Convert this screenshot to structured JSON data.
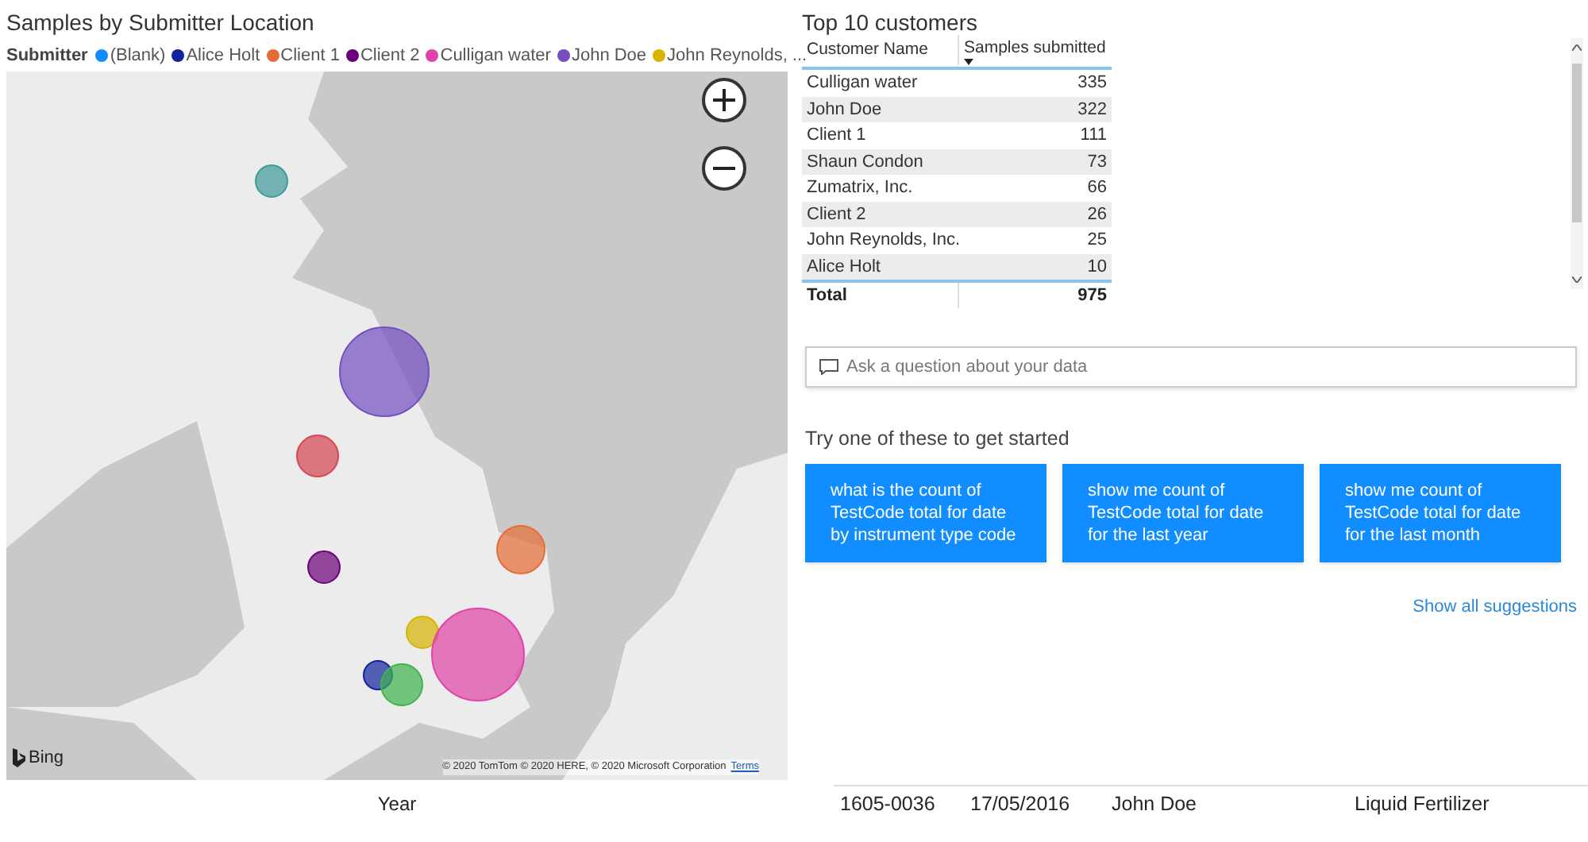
{
  "map_visual": {
    "title": "Samples by Submitter Location",
    "legend": {
      "title": "Submitter",
      "items": [
        {
          "label": "(Blank)",
          "color": "#118dff"
        },
        {
          "label": "Alice Holt",
          "color": "#12239e"
        },
        {
          "label": "Client 1",
          "color": "#e66c37"
        },
        {
          "label": "Client 2",
          "color": "#6b007b"
        },
        {
          "label": "Culligan water",
          "color": "#e044a7"
        },
        {
          "label": "John Doe",
          "color": "#744ec2"
        },
        {
          "label": "John Reynolds, ...",
          "color": "#d9b300"
        }
      ]
    },
    "bubbles": [
      {
        "color": "#3f9a9a"
      },
      {
        "color": "#744ec2"
      },
      {
        "color": "#d64550"
      },
      {
        "color": "#e66c37"
      },
      {
        "color": "#6b007b"
      },
      {
        "color": "#d9b300"
      },
      {
        "color": "#e044a7"
      },
      {
        "color": "#12239e"
      },
      {
        "color": "#3fb34f"
      }
    ],
    "attribution": {
      "brand": "Bing",
      "copyright": "© 2020 TomTom © 2020 HERE, © 2020 Microsoft Corporation",
      "terms_link": "Terms"
    },
    "axis_label": "Year"
  },
  "top_customers": {
    "title": "Top 10 customers",
    "columns": [
      "Customer Name",
      "Samples submitted"
    ],
    "rows": [
      [
        "Culligan water",
        "335"
      ],
      [
        "John Doe",
        "322"
      ],
      [
        "Client 1",
        "111"
      ],
      [
        "Shaun Condon",
        "73"
      ],
      [
        "Zumatrix, Inc.",
        "66"
      ],
      [
        "Client 2",
        "26"
      ],
      [
        "John Reynolds, Inc.",
        "25"
      ],
      [
        "Alice Holt",
        "10"
      ]
    ],
    "total": [
      "Total",
      "975"
    ]
  },
  "qna": {
    "placeholder": "Ask a question about your data",
    "prompt": "Try one of these to get started",
    "suggestions": [
      "what is the count of TestCode total for date by instrument type code",
      "show me count of TestCode total for date for the last year",
      "show me count of TestCode total for date for the last month"
    ],
    "show_all_link": "Show all suggestions"
  },
  "bottom_row": [
    "1605-0036",
    "17/05/2016",
    "John Doe",
    "Liquid Fertilizer"
  ]
}
